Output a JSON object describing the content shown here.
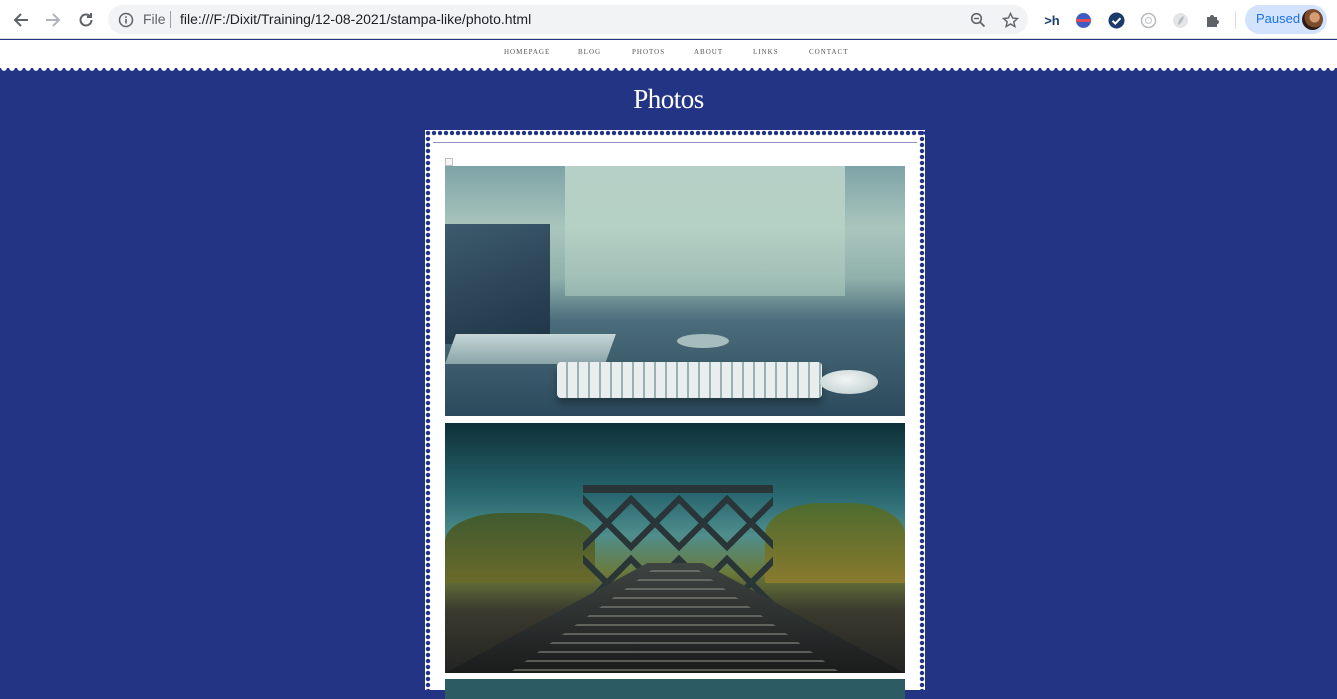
{
  "browser": {
    "omnibox": {
      "scheme_label": "File",
      "url": "file:///F:/Dixit/Training/12-08-2021/stampa-like/photo.html"
    },
    "profile": {
      "status_label": "Paused"
    },
    "extensions": [
      {
        "icon": "h-extension-icon",
        "label": ">h"
      },
      {
        "icon": "globe-extension-icon"
      },
      {
        "icon": "check-extension-icon"
      },
      {
        "icon": "circle-extension-icon"
      },
      {
        "icon": "leaf-extension-icon"
      },
      {
        "icon": "puzzle-icon"
      }
    ]
  },
  "site": {
    "nav": [
      "HOMEPAGE",
      "BLOG",
      "PHOTOS",
      "ABOUT",
      "LINKS",
      "CONTACT"
    ],
    "page_title": "Photos",
    "colors": {
      "background": "#243485",
      "card": "#ffffff"
    }
  },
  "photos": [
    {
      "subject": "laptop-keyboard-desk"
    },
    {
      "subject": "railway-bridge"
    },
    {
      "subject": "third-photo-partial"
    }
  ]
}
